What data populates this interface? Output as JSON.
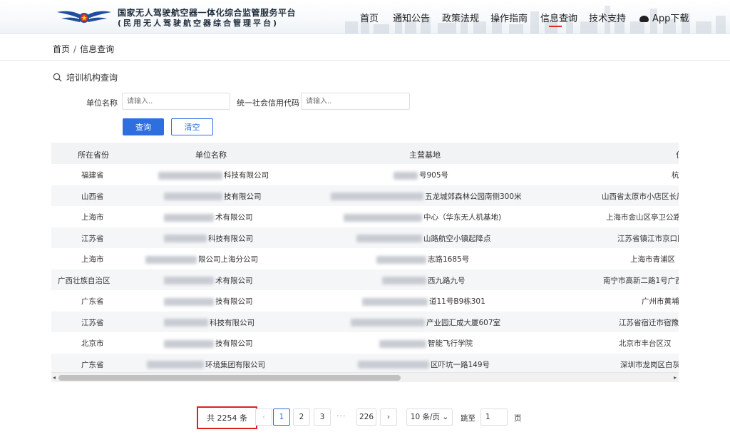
{
  "header": {
    "title": "国家无人驾驶航空器一体化综合监管服务平台",
    "subtitle": "(民用无人驾驶航空器综合管理平台)",
    "nav": [
      {
        "label": "首页"
      },
      {
        "label": "通知公告"
      },
      {
        "label": "政策法规"
      },
      {
        "label": "操作指南"
      },
      {
        "label": "信息查询",
        "active": true
      },
      {
        "label": "技术支持"
      },
      {
        "label": "App下载",
        "icon": "cloud-download-icon"
      }
    ],
    "accent": "#d9302a"
  },
  "breadcrumb": {
    "home": "首页",
    "separator": "/",
    "current": "信息查询"
  },
  "section": {
    "title": "培训机构查询",
    "icon": "search-icon"
  },
  "form": {
    "unit_name_label": "单位名称",
    "unit_name_placeholder": "请输入..",
    "credit_code_label": "统一社会信用代码",
    "credit_code_placeholder": "请输入..",
    "query_button": "查询",
    "clear_button": "清空",
    "primary_color": "#2d6fe0"
  },
  "table": {
    "columns": [
      "所在省份",
      "单位名称",
      "主营基地",
      "住"
    ],
    "rows": [
      {
        "province": "福建省",
        "unit": "科技有限公司",
        "base": "号905号",
        "addr": "杭"
      },
      {
        "province": "山西省",
        "unit": "技有限公司",
        "base": "五龙城郊森林公园南侧300米",
        "addr": "山西省太原市小店区长风"
      },
      {
        "province": "上海市",
        "unit": "术有限公司",
        "base": "中心（华东无人机基地)",
        "addr": "上海市金山区亭卫公路"
      },
      {
        "province": "江苏省",
        "unit": "科技有限公司",
        "base": "山路航空小镇起降点",
        "addr": "江苏省镇江市京口区"
      },
      {
        "province": "上海市",
        "unit": "限公司上海分公司",
        "base": "志路1685号",
        "addr": "上海市青浦区"
      },
      {
        "province": "广西壮族自治区",
        "unit": "术有限公司",
        "base": "西九路九号",
        "addr": "南宁市高新二路1号广西"
      },
      {
        "province": "广东省",
        "unit": "技有限公司",
        "base": "道11号B9栋301",
        "addr": "广州市黄埔区"
      },
      {
        "province": "江苏省",
        "unit": "科技有限公司",
        "base": "产业园汇成大厦607室",
        "addr": "江苏省宿迁市宿豫"
      },
      {
        "province": "北京市",
        "unit": "技有限公司",
        "base": "智能飞行学院",
        "addr": "北京市丰台区汉"
      },
      {
        "province": "广东省",
        "unit": "环境集团有限公司",
        "base": "区吓坑一路149号",
        "addr": "深圳市龙岗区白灰"
      }
    ]
  },
  "pagination": {
    "total": "共 2254 条",
    "prev": "‹",
    "pages": [
      "1",
      "2",
      "3"
    ],
    "dots": "···",
    "last": "226",
    "next": "›",
    "page_size": "10 条/页",
    "jump_label": "跳至",
    "jump_value": "1",
    "jump_unit": "页",
    "highlight_color": "#e02020"
  }
}
